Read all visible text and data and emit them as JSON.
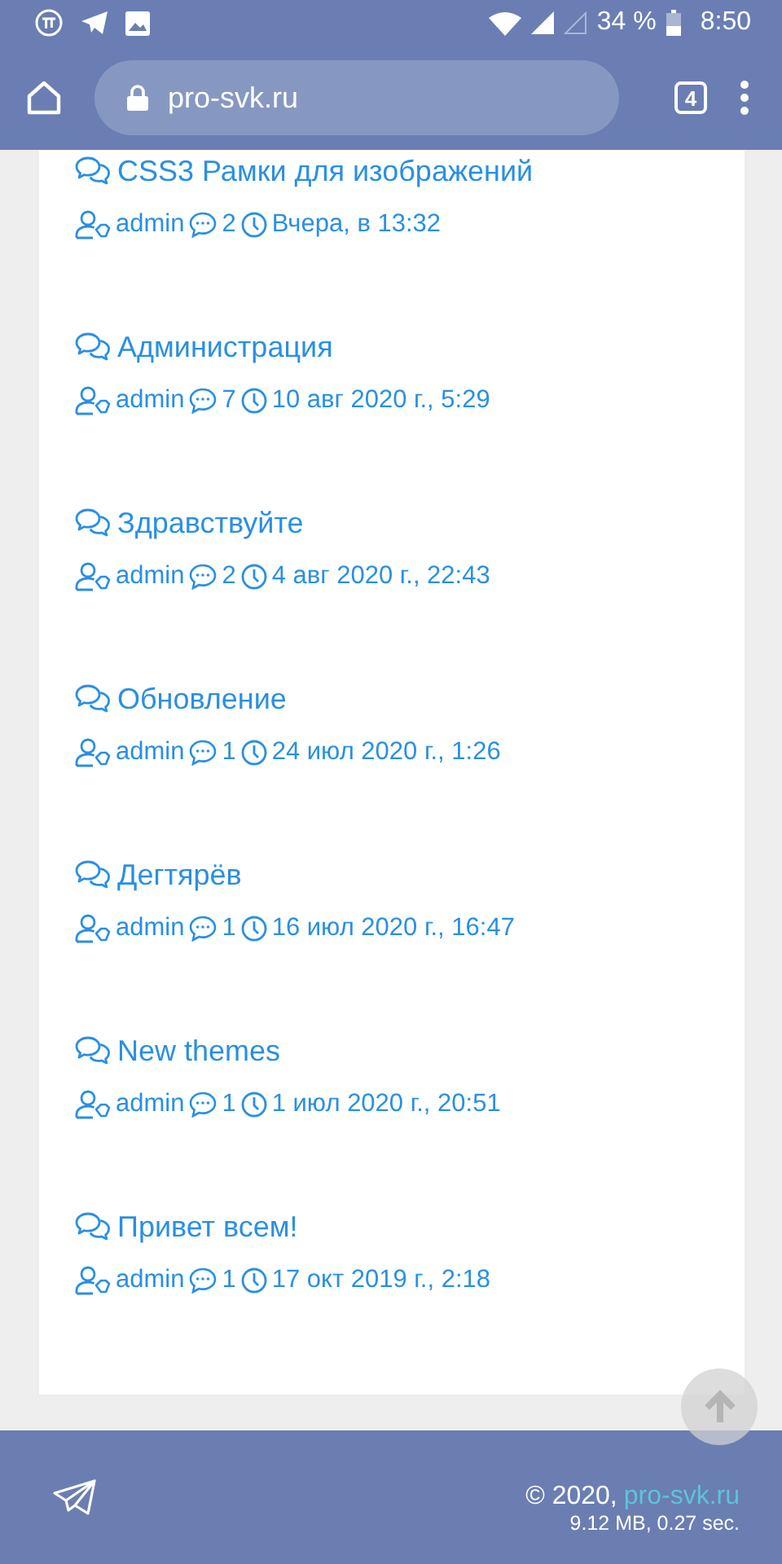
{
  "status_bar": {
    "battery": "34 %",
    "time": "8:50"
  },
  "browser": {
    "url": "pro-svk.ru",
    "tab_count": "4"
  },
  "posts": [
    {
      "title": "CSS3 Рамки для изображений",
      "author": "admin",
      "comments": "2",
      "date": "Вчера, в 13:32"
    },
    {
      "title": "Администрация",
      "author": "admin",
      "comments": "7",
      "date": "10 авг 2020 г., 5:29"
    },
    {
      "title": "Здравствуйте",
      "author": "admin",
      "comments": "2",
      "date": "4 авг 2020 г., 22:43"
    },
    {
      "title": "Обновление",
      "author": "admin",
      "comments": "1",
      "date": "24 июл 2020 г., 1:26"
    },
    {
      "title": "Дегтярёв",
      "author": "admin",
      "comments": "1",
      "date": "16 июл 2020 г., 16:47"
    },
    {
      "title": "New themes",
      "author": "admin",
      "comments": "1",
      "date": "1 июл 2020 г., 20:51"
    },
    {
      "title": "Привет всем!",
      "author": "admin",
      "comments": "1",
      "date": "17 окт 2019 г., 2:18"
    }
  ],
  "footer": {
    "copyright": "© 2020,",
    "site_link": "pro-svk.ru",
    "stats": "9.12 MB, 0.27 sec."
  }
}
